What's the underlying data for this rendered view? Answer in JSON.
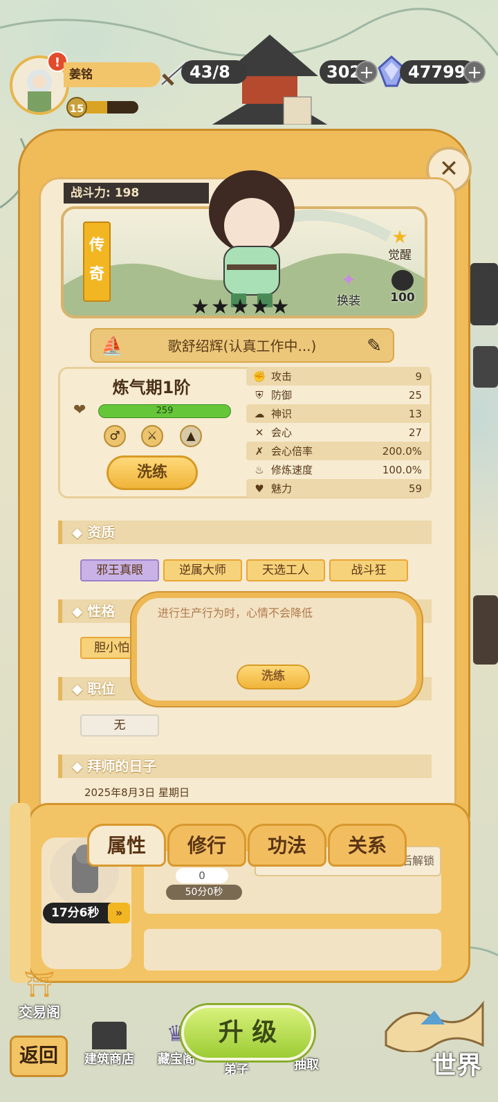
{
  "player": {
    "name": "姜铭",
    "level": "15",
    "exp_fraction": 0.45
  },
  "resources": {
    "stamina": "43/8",
    "currency_partial": "302",
    "gems": "47799"
  },
  "hero": {
    "combat_power": "战斗力: 198",
    "rarity": "传奇",
    "stars": "★★★★★",
    "awaken_label": "觉醒",
    "change_outfit_label": "换装",
    "portrait_count": "100",
    "name_status": "歌舒绍辉(认真工作中...)",
    "realm": "炼气期1阶",
    "hp": "259",
    "refine_label": "洗练",
    "stats": [
      {
        "icon": "✊",
        "label": "攻击",
        "value": "9"
      },
      {
        "icon": "⛨",
        "label": "防御",
        "value": "25"
      },
      {
        "icon": "☁",
        "label": "神识",
        "value": "13"
      },
      {
        "icon": "✕",
        "label": "会心",
        "value": "27"
      },
      {
        "icon": "✗",
        "label": "会心倍率",
        "value": "200.0%"
      },
      {
        "icon": "♨",
        "label": "修炼速度",
        "value": "100.0%"
      },
      {
        "icon": "♥",
        "label": "魅力",
        "value": "59"
      }
    ]
  },
  "sections": {
    "aptitude": {
      "title": "◆ 资质",
      "tags": [
        "邪王真眼",
        "逆属大师",
        "天选工人",
        "战斗狂"
      ]
    },
    "personality": {
      "title": "◆ 性格",
      "tag": "胆小怕"
    },
    "position": {
      "title": "◆ 职位",
      "value": "无"
    },
    "apprentice": {
      "title": "◆ 拜师的日子",
      "date": "2025年8月3日 星期日"
    }
  },
  "tooltip": {
    "text": "进行生产行为时，心情不会降低",
    "button": "洗练"
  },
  "tabs": [
    "属性",
    "修行",
    "功法",
    "关系"
  ],
  "lower": {
    "timer": "17分6秒",
    "counter": "0",
    "duration": "50分0秒",
    "unlock_text": "后解锁"
  },
  "bottom": {
    "trade": "交易阁",
    "back": "返回",
    "build_shop": "建筑商店",
    "treasure": "藏宝阁",
    "disciple": "弟子",
    "draw": "抽取",
    "upgrade": "升 级",
    "world": "世界"
  }
}
